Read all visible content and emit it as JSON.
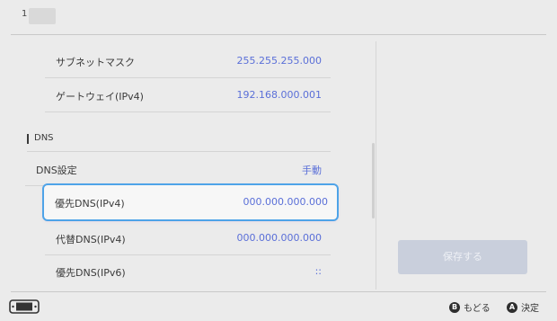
{
  "header": {
    "back": "1"
  },
  "rows_top": [
    {
      "label": "サブネットマスク",
      "value": "255.255.255.000"
    },
    {
      "label": "ゲートウェイ(IPv4)",
      "value": "192.168.000.001"
    }
  ],
  "dns_section": {
    "title": "DNS"
  },
  "dns_setting": {
    "label": "DNS設定",
    "value": "手動"
  },
  "dns_rows": [
    {
      "label": "優先DNS(IPv4)",
      "value": "000.000.000.000"
    },
    {
      "label": "代替DNS(IPv4)",
      "value": "000.000.000.000"
    },
    {
      "label": "優先DNS(IPv6)",
      "value": "::"
    }
  ],
  "save_button": {
    "label": "保存する"
  },
  "footer": {
    "back_glyph": "B",
    "back_label": "もどる",
    "ok_glyph": "A",
    "ok_label": "決定"
  },
  "colors": {
    "accent": "#5a6fd8",
    "focus": "#4ea3e8",
    "disabled_button": "#c9cfdc"
  },
  "icons": [
    "console-icon",
    "b-button-icon",
    "a-button-icon"
  ]
}
